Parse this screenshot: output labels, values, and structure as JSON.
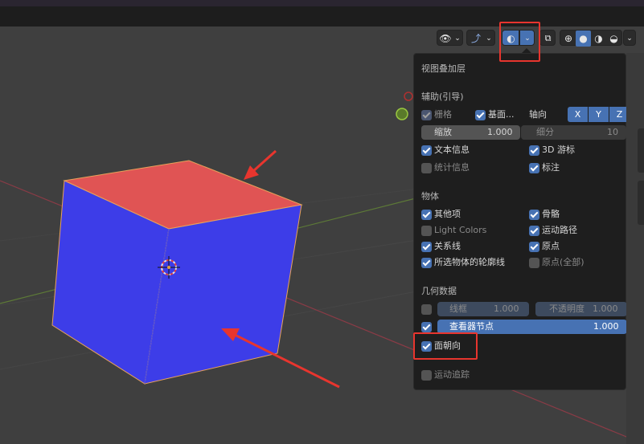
{
  "panel": {
    "title": "视图叠加层",
    "guides_section": "辅助(引导)",
    "grid_label": "栅格",
    "floor_label": "基面...",
    "axis_label": "轴向",
    "axis_x": "X",
    "axis_y": "Y",
    "axis_z": "Z",
    "scale_label": "缩放",
    "scale_value": "1.000",
    "subdiv_label": "细分",
    "subdiv_value": "10",
    "text_info_label": "文本信息",
    "cursor_label": "3D 游标",
    "stats_label": "统计信息",
    "annotations_label": "标注",
    "objects_section": "物体",
    "extras_label": "其他项",
    "bones_label": "骨骼",
    "light_colors_label": "Light Colors",
    "motion_paths_label": "运动路径",
    "relations_label": "关系线",
    "origins_label": "原点",
    "outline_label": "所选物体的轮廓线",
    "origins_all_label": "原点(全部)",
    "geometry_section": "几何数据",
    "wireframe_label": "线框",
    "wireframe_value": "1.000",
    "opacity_label": "不透明度",
    "opacity_value": "1.000",
    "viewer_node_label": "查看器节点",
    "viewer_node_value": "1.000",
    "face_orientation_label": "面朝向",
    "motion_tracking_label": "运动追踪"
  },
  "colors": {
    "accent": "#4772b3",
    "cube_front": "#3d3de8",
    "cube_top": "#e05454",
    "annotation_red": "#e8352e"
  },
  "icons": [
    "eye-icon",
    "gizmo-icon",
    "overlay-icon",
    "xray-icon",
    "wireframe-shading-icon",
    "solid-shading-icon",
    "material-shading-icon",
    "rendered-shading-icon",
    "chevron-down-icon"
  ]
}
